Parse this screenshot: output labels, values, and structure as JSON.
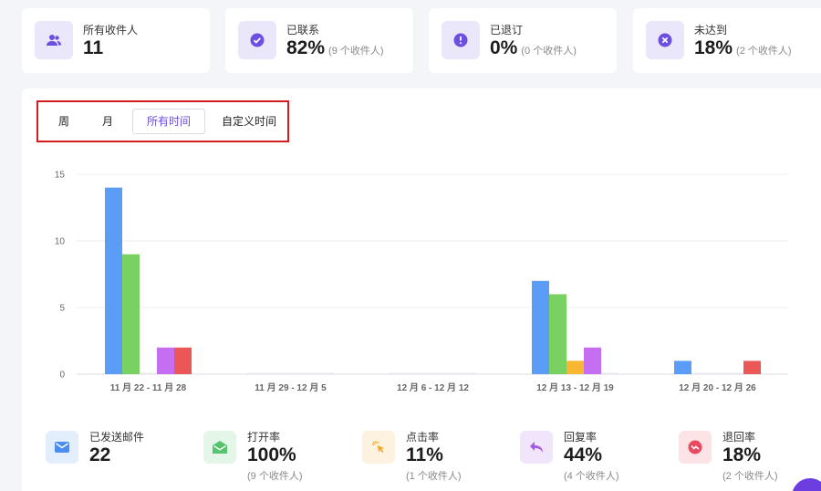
{
  "stats": [
    {
      "label": "所有收件人",
      "value": "11",
      "sub": "",
      "icon": "users-icon"
    },
    {
      "label": "已联系",
      "value": "82%",
      "sub": "(9 个收件人)",
      "icon": "check-circle-icon"
    },
    {
      "label": "已退订",
      "value": "0%",
      "sub": "(0 个收件人)",
      "icon": "alert-circle-icon"
    },
    {
      "label": "未达到",
      "value": "18%",
      "sub": "(2 个收件人)",
      "icon": "x-circle-icon"
    }
  ],
  "tabs": [
    "周",
    "月",
    "所有时间",
    "自定义时间"
  ],
  "active_tab": "所有时间",
  "chart_data": {
    "type": "bar",
    "categories": [
      "11 月 22 - 11 月 28",
      "11 月 29 - 12 月 5",
      "12 月 6 - 12 月 12",
      "12 月 13 - 12 月 19",
      "12 月 20 - 12 月 26"
    ],
    "series": [
      {
        "color": "#5b9cf6",
        "values": [
          14,
          0,
          0,
          7,
          1
        ]
      },
      {
        "color": "#79d161",
        "values": [
          9,
          0,
          0,
          6,
          0
        ]
      },
      {
        "color": "#f7b731",
        "values": [
          0,
          0,
          0,
          1,
          0
        ]
      },
      {
        "color": "#c66ef2",
        "values": [
          2,
          0,
          0,
          2,
          0
        ]
      },
      {
        "color": "#eb5757",
        "values": [
          2,
          0,
          0,
          0,
          1
        ]
      }
    ],
    "ylim": [
      0,
      15
    ],
    "yticks": [
      "0",
      "5",
      "10",
      "15"
    ],
    "grid": true
  },
  "metrics": [
    {
      "label": "已发送邮件",
      "value": "22",
      "sub": "",
      "icon": "mail-icon",
      "color": "#4b8df0",
      "bg": "#e3eefc"
    },
    {
      "label": "打开率",
      "value": "100%",
      "sub": "(9 个收件人)",
      "icon": "open-envelope-icon",
      "color": "#55c46d",
      "bg": "#e4f6e7"
    },
    {
      "label": "点击率",
      "value": "11%",
      "sub": "(1 个收件人)",
      "icon": "cursor-click-icon",
      "color": "#f5a623",
      "bg": "#fdf1df"
    },
    {
      "label": "回复率",
      "value": "44%",
      "sub": "(4 个收件人)",
      "icon": "reply-icon",
      "color": "#a55be8",
      "bg": "#f1e5fc"
    },
    {
      "label": "退回率",
      "value": "18%",
      "sub": "(2 个收件人)",
      "icon": "bounce-icon",
      "color": "#e84a5f",
      "bg": "#fce3e6"
    }
  ]
}
